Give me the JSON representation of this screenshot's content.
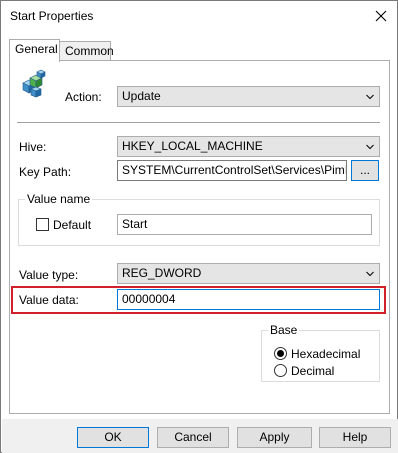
{
  "window": {
    "title": "Start Properties"
  },
  "tabs": [
    {
      "label": "General"
    },
    {
      "label": "Common"
    }
  ],
  "action": {
    "label": "Action:",
    "value": "Update"
  },
  "hive": {
    "label": "Hive:",
    "value": "HKEY_LOCAL_MACHINE"
  },
  "key_path": {
    "label": "Key Path:",
    "value": "SYSTEM\\CurrentControlSet\\Services\\PimIndex",
    "browse_label": "..."
  },
  "value_name": {
    "group_label": "Value name",
    "default_label": "Default",
    "default_checked": false,
    "value": "Start"
  },
  "value_type": {
    "label": "Value type:",
    "value": "REG_DWORD"
  },
  "value_data": {
    "label": "Value data:",
    "value": "00000004"
  },
  "base": {
    "group_label": "Base",
    "hex_label": "Hexadecimal",
    "dec_label": "Decimal",
    "selected": "Hexadecimal"
  },
  "buttons": {
    "ok": "OK",
    "cancel": "Cancel",
    "apply": "Apply",
    "help": "Help"
  },
  "colors": {
    "highlight": "#d0202a",
    "default_button_border": "#0078d7"
  },
  "icons": {
    "close": "close-icon",
    "registry": "registry-icon",
    "dropdown": "chevron-down-icon"
  }
}
